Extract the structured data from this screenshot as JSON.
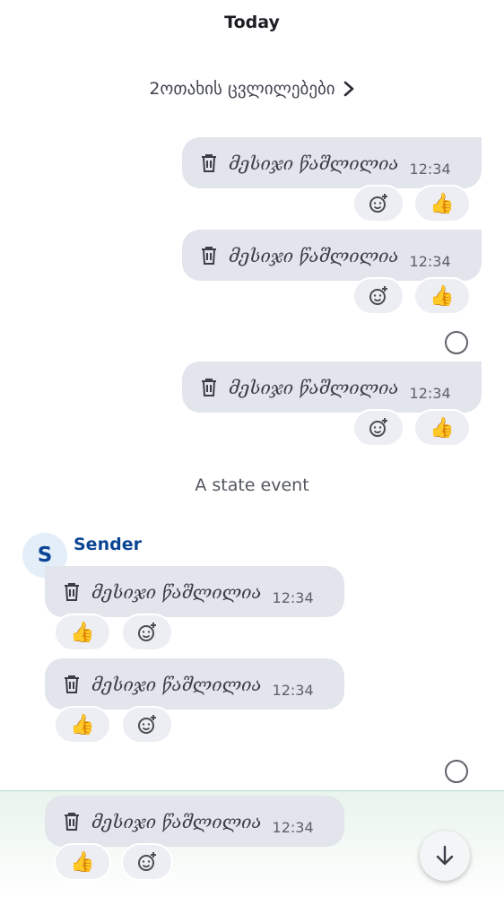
{
  "timeline": {
    "date_header": "Today",
    "room_changes": "2ოთახის ცვლილებები",
    "state_event": "A state event",
    "deleted_text": "მესიჯი წაშლილია",
    "time": "12:34",
    "thumbs": "👍",
    "sender_name": "Sender",
    "sender_initial": "S"
  },
  "icons": {
    "trash": "trash-icon",
    "add_reaction": "add-reaction-icon",
    "chevron": "chevron-right-icon",
    "read_receipt": "read-receipt-icon",
    "scroll_down": "arrow-down-icon"
  },
  "colors": {
    "bubble": "#e2e5ec",
    "reaction": "#eceef3",
    "sender": "#0b4595",
    "composer_border": "#b7d8c5"
  }
}
